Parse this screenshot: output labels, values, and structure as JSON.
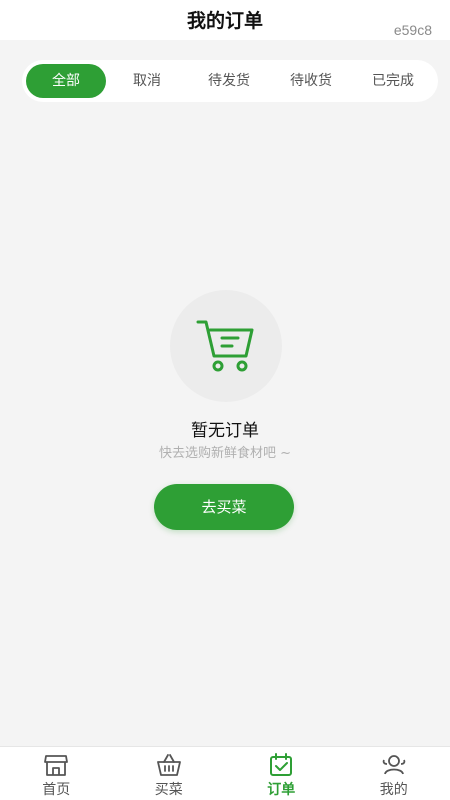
{
  "header": {
    "title": "我的订单",
    "build_code": "e59c8"
  },
  "tabs": [
    {
      "label": "全部",
      "active": true
    },
    {
      "label": "取消",
      "active": false
    },
    {
      "label": "待发货",
      "active": false
    },
    {
      "label": "待收货",
      "active": false
    },
    {
      "label": "已完成",
      "active": false
    }
  ],
  "empty_state": {
    "icon": "shopping-cart-icon",
    "title": "暂无订单",
    "subtitle": "快去选购新鲜食材吧 ~",
    "button_label": "去买菜"
  },
  "tabbar": [
    {
      "label": "首页",
      "icon": "store-icon",
      "active": false
    },
    {
      "label": "买菜",
      "icon": "basket-icon",
      "active": false
    },
    {
      "label": "订单",
      "icon": "calendar-check-icon",
      "active": true
    },
    {
      "label": "我的",
      "icon": "users-icon",
      "active": false
    }
  ],
  "colors": {
    "accent": "#2e9f35",
    "background": "#f4f4f4",
    "inactive_text": "#555555",
    "muted_text": "#b0b0b0"
  }
}
